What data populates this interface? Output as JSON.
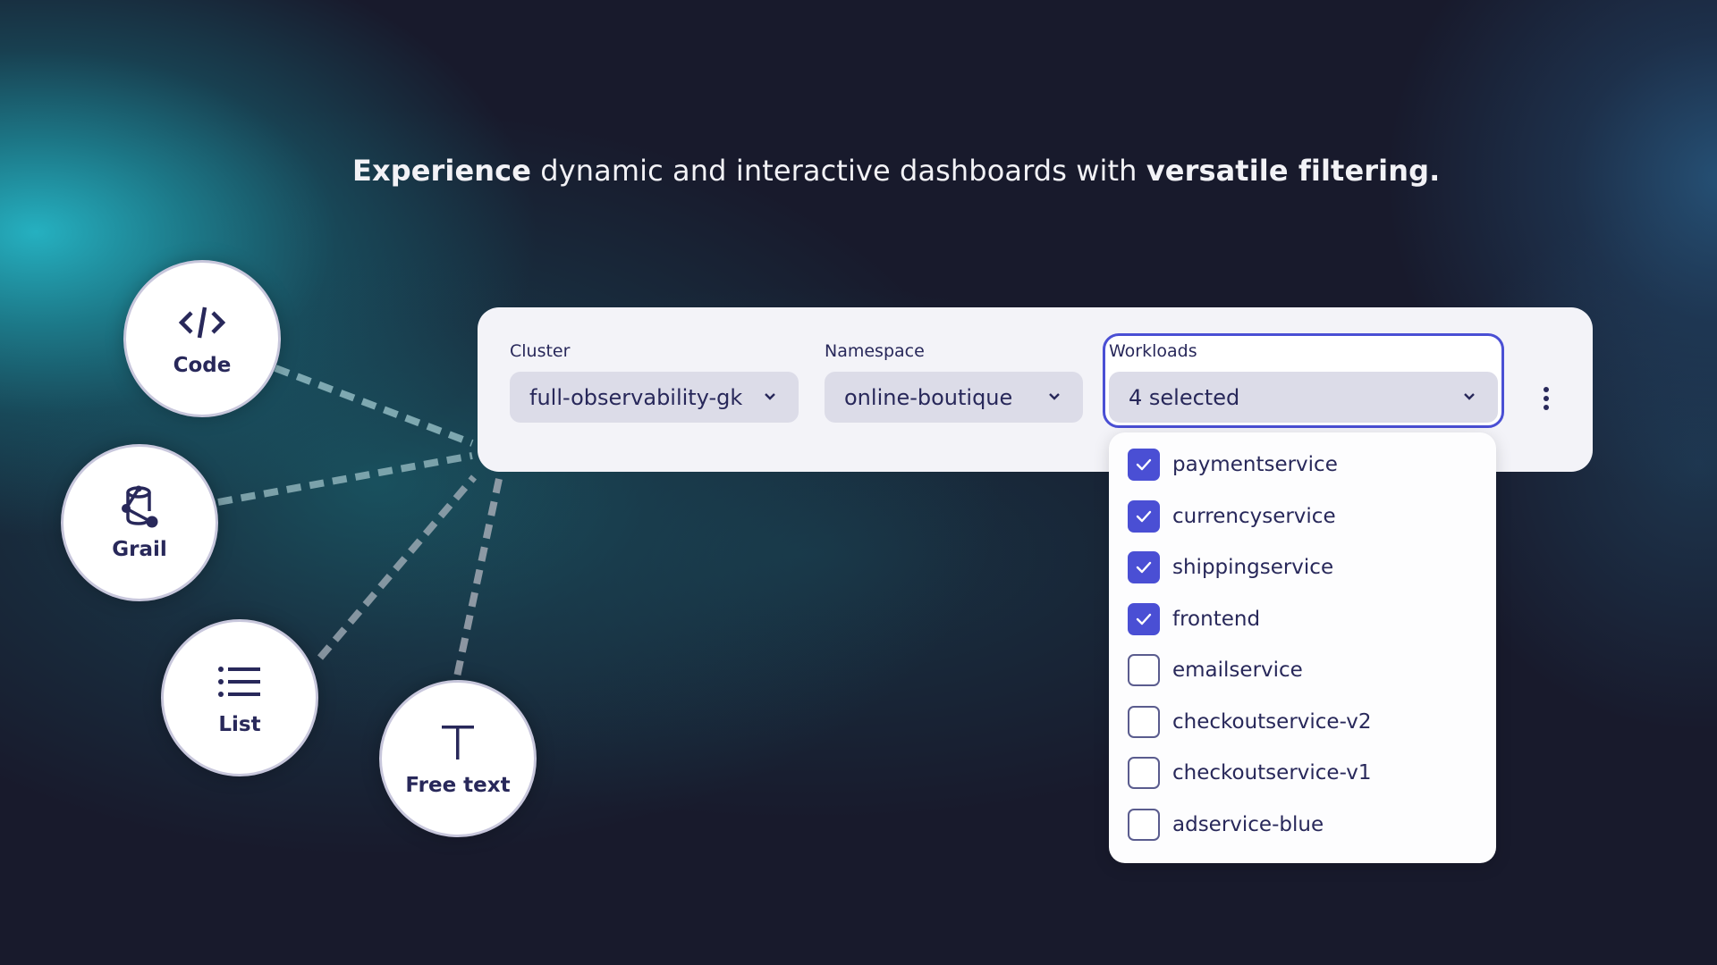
{
  "headline": {
    "bold_start": "Experience",
    "middle": " dynamic and interactive dashboards with ",
    "bold_end": "versatile filtering."
  },
  "filter_types": [
    {
      "label": "Code",
      "icon": "code-icon"
    },
    {
      "label": "Grail",
      "icon": "grail-icon"
    },
    {
      "label": "List",
      "icon": "list-icon"
    },
    {
      "label": "Free text",
      "icon": "text-icon"
    }
  ],
  "filters": {
    "cluster": {
      "label": "Cluster",
      "value": "full-observability-gk"
    },
    "namespace": {
      "label": "Namespace",
      "value": "online-boutique"
    },
    "workloads": {
      "label": "Workloads",
      "value": "4 selected",
      "focused": true
    }
  },
  "workload_options": [
    {
      "label": "paymentservice",
      "checked": true
    },
    {
      "label": "currencyservice",
      "checked": true
    },
    {
      "label": "shippingservice",
      "checked": true
    },
    {
      "label": "frontend",
      "checked": true
    },
    {
      "label": "emailservice",
      "checked": false
    },
    {
      "label": "checkoutservice-v2",
      "checked": false
    },
    {
      "label": "checkoutservice-v1",
      "checked": false
    },
    {
      "label": "adservice-blue",
      "checked": false
    }
  ],
  "colors": {
    "accent": "#4a4fd4",
    "text_dark": "#28285a",
    "background": "#181a2c",
    "glow": "#26b8c8"
  }
}
